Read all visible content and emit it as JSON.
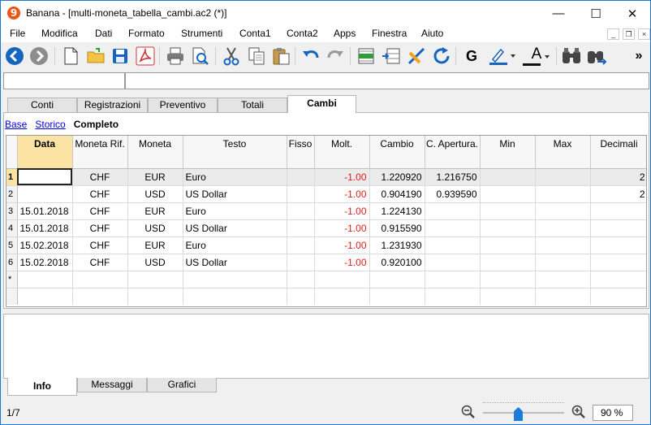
{
  "window": {
    "title": "Banana - [multi-moneta_tabella_cambi.ac2 (*)]",
    "logo_glyph": "9",
    "minimize": "—",
    "maximize": "☐",
    "close": "✕"
  },
  "menu": [
    "File",
    "Modifica",
    "Dati",
    "Formato",
    "Strumenti",
    "Conta1",
    "Conta2",
    "Apps",
    "Finestra",
    "Aiuto"
  ],
  "mdi_controls": [
    "_",
    "❐",
    "×"
  ],
  "toolbar": {
    "bold_label": "G",
    "text_color_label": "A",
    "more_label": "»",
    "accent_blue": "#1565c0",
    "accent_red": "#d32f2f",
    "accent_orange": "#f4a21c"
  },
  "tabs": [
    {
      "label": "Conti",
      "active": false
    },
    {
      "label": "Registrazioni",
      "active": false
    },
    {
      "label": "Preventivo",
      "active": false
    },
    {
      "label": "Totali",
      "active": false
    },
    {
      "label": "Cambi",
      "active": true
    }
  ],
  "views": {
    "base": "Base",
    "storico": "Storico",
    "completo": "Completo"
  },
  "table": {
    "columns": [
      "Data",
      "Moneta Rif.",
      "Moneta",
      "Testo",
      "Fisso",
      "Molt.",
      "Cambio",
      "C. Apertura.",
      "Min",
      "Max",
      "Decimali"
    ],
    "rows": [
      {
        "n": "1",
        "data": "",
        "rif": "CHF",
        "moneta": "EUR",
        "testo": "Euro",
        "fisso": "",
        "molt": "-1.00",
        "cambio": "1.220920",
        "apertura": "1.216750",
        "min": "",
        "max": "",
        "dec": "2"
      },
      {
        "n": "2",
        "data": "",
        "rif": "CHF",
        "moneta": "USD",
        "testo": "US Dollar",
        "fisso": "",
        "molt": "-1.00",
        "cambio": "0.904190",
        "apertura": "0.939590",
        "min": "",
        "max": "",
        "dec": "2"
      },
      {
        "n": "3",
        "data": "15.01.2018",
        "rif": "CHF",
        "moneta": "EUR",
        "testo": "Euro",
        "fisso": "",
        "molt": "-1.00",
        "cambio": "1.224130",
        "apertura": "",
        "min": "",
        "max": "",
        "dec": ""
      },
      {
        "n": "4",
        "data": "15.01.2018",
        "rif": "CHF",
        "moneta": "USD",
        "testo": "US Dollar",
        "fisso": "",
        "molt": "-1.00",
        "cambio": "0.915590",
        "apertura": "",
        "min": "",
        "max": "",
        "dec": ""
      },
      {
        "n": "5",
        "data": "15.02.2018",
        "rif": "CHF",
        "moneta": "EUR",
        "testo": "Euro",
        "fisso": "",
        "molt": "-1.00",
        "cambio": "1.231930",
        "apertura": "",
        "min": "",
        "max": "",
        "dec": ""
      },
      {
        "n": "6",
        "data": "15.02.2018",
        "rif": "CHF",
        "moneta": "USD",
        "testo": "US Dollar",
        "fisso": "",
        "molt": "-1.00",
        "cambio": "0.920100",
        "apertura": "",
        "min": "",
        "max": "",
        "dec": ""
      }
    ],
    "new_row_marker": "*"
  },
  "bottom_tabs": [
    {
      "label": "Info",
      "active": true
    },
    {
      "label": "Messaggi",
      "active": false
    },
    {
      "label": "Grafici",
      "active": false
    }
  ],
  "status": {
    "text": "1/7",
    "zoom": "90 %",
    "zoom_level_percent": 90
  }
}
